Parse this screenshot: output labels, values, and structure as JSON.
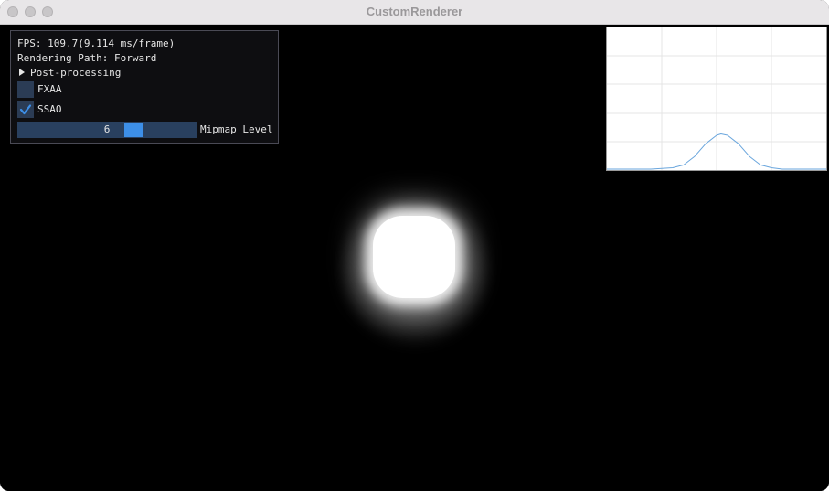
{
  "window": {
    "title": "CustomRenderer"
  },
  "overlay": {
    "fps_text": "FPS: 109.7(9.114 ms/frame)",
    "rendering_path_text": "Rendering Path: Forward",
    "post_processing_label": "Post-processing",
    "fxaa": {
      "label": "FXAA",
      "checked": false
    },
    "ssao": {
      "label": "SSAO",
      "checked": true
    },
    "mipmap": {
      "label": "Mipmap Level",
      "value": "6",
      "fraction": 0.67
    }
  },
  "colors": {
    "accent": "#3d8fe8",
    "widget_bg": "#2b3c55",
    "graph_line": "#6aa6dd",
    "viewport_bg": "#000000"
  },
  "chart_data": {
    "type": "line",
    "title": "",
    "xlabel": "",
    "ylabel": "",
    "grid": true,
    "xlim": [
      0,
      1
    ],
    "ylim": [
      0,
      1
    ],
    "series": [
      {
        "x": [
          0,
          0.1,
          0.2,
          0.3,
          0.35,
          0.4,
          0.45,
          0.5,
          0.52,
          0.55,
          0.6,
          0.65,
          0.7,
          0.75,
          0.8,
          0.9,
          1.0
        ],
        "y": [
          0,
          0,
          0,
          0.01,
          0.03,
          0.09,
          0.18,
          0.24,
          0.25,
          0.24,
          0.18,
          0.09,
          0.03,
          0.01,
          0,
          0,
          0
        ]
      }
    ]
  }
}
